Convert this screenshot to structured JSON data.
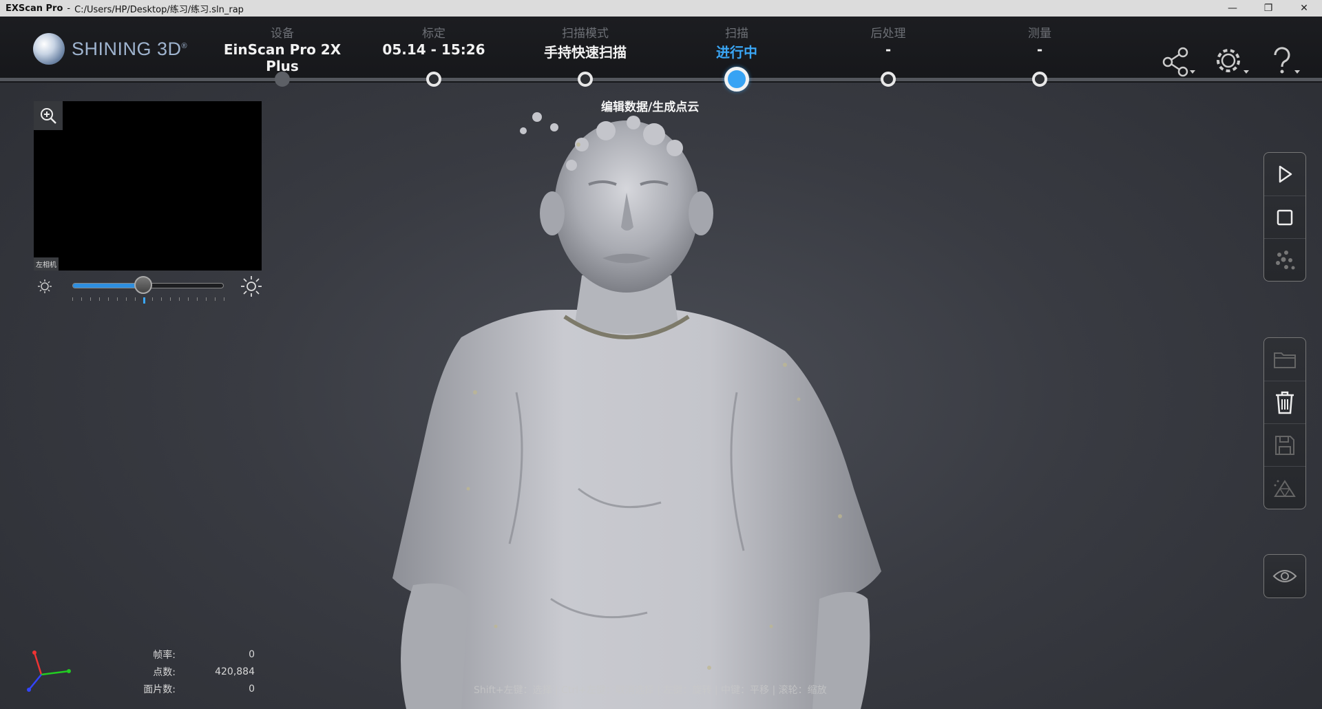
{
  "window": {
    "app_name": "EXScan Pro",
    "separator": "-",
    "file_path": "C:/Users/HP/Desktop/练习/练习.sln_rap"
  },
  "logo": {
    "text": "SHINING 3D",
    "mark": "®"
  },
  "steps": [
    {
      "label": "设备",
      "value": "EinScan Pro 2X Plus",
      "state": "done"
    },
    {
      "label": "标定",
      "value": "05.14 - 15:26",
      "state": "pending"
    },
    {
      "label": "扫描模式",
      "value": "手持快速扫描",
      "state": "pending"
    },
    {
      "label": "扫描",
      "value": "进行中",
      "state": "active"
    },
    {
      "label": "后处理",
      "value": "-",
      "state": "pending"
    },
    {
      "label": "测量",
      "value": "-",
      "state": "pending"
    }
  ],
  "stage_caption": "编辑数据/生成点云",
  "camera": {
    "label": "左相机",
    "brightness_fraction": 0.47
  },
  "stats": [
    {
      "key": "帧率:",
      "value": "0"
    },
    {
      "key": "点数:",
      "value": "420,884"
    },
    {
      "key": "面片数:",
      "value": "0"
    }
  ],
  "hint": "Shift+左键：选择 | Ctrl+左键：取消选择 | 左键：旋转 | 中键：平移 | 滚轮：缩放",
  "colors": {
    "accent": "#37a3f4",
    "header_bg": "#1a1b1e",
    "viewport_bg": "#3a3c42"
  },
  "icons": {
    "header": [
      "share-icon",
      "settings-icon",
      "help-icon"
    ],
    "scan_controls": [
      "play-icon",
      "stop-icon",
      "point-cloud-icon"
    ],
    "file_tools": [
      "folder-icon",
      "trash-icon",
      "save-icon",
      "mesh-icon"
    ],
    "view": [
      "eye-icon"
    ]
  }
}
